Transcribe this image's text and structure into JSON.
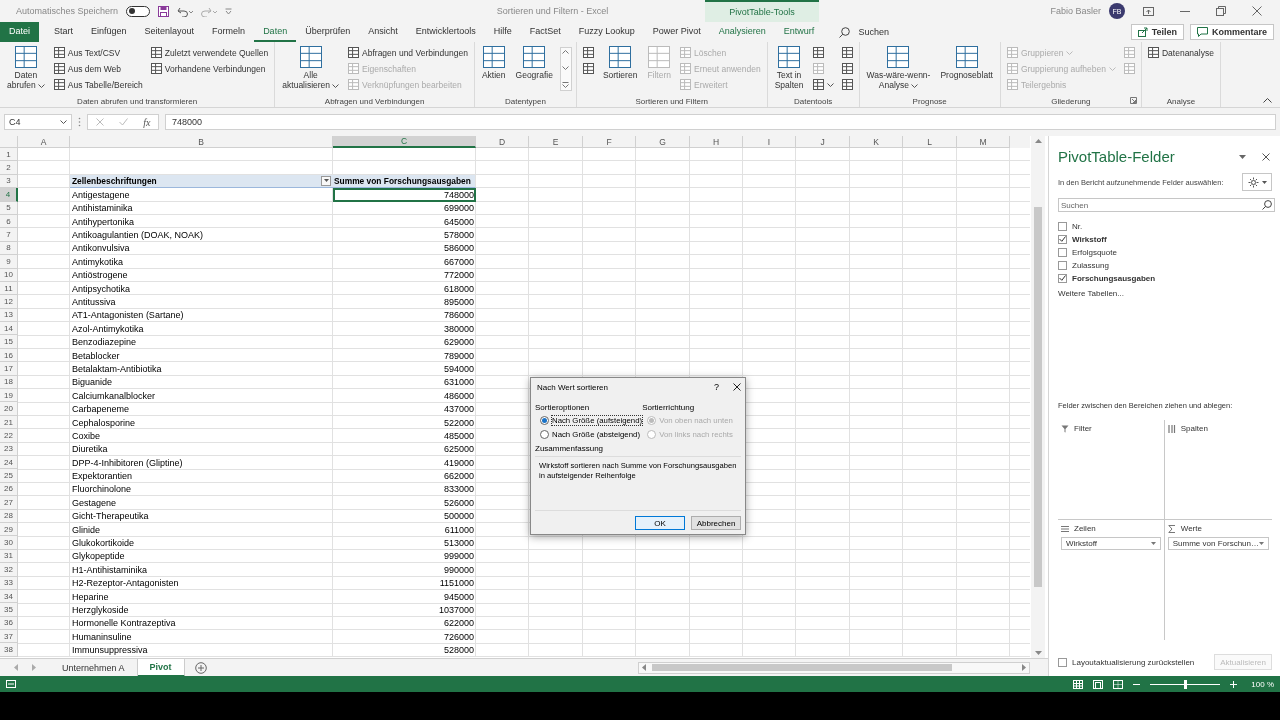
{
  "title_bar": {
    "autosave_label": "Automatisches Speichern",
    "autosave_on": false,
    "document_title": "Sortieren und Filtern - Excel",
    "context_tab": "PivotTable-Tools",
    "user_name": "Fabio Basler",
    "user_initials": "FB"
  },
  "ribbon_tabs": [
    {
      "label": "Datei",
      "kind": "file",
      "selected": false
    },
    {
      "label": "Start",
      "kind": "normal",
      "selected": false
    },
    {
      "label": "Einfügen",
      "kind": "normal",
      "selected": false
    },
    {
      "label": "Seitenlayout",
      "kind": "normal",
      "selected": false
    },
    {
      "label": "Formeln",
      "kind": "normal",
      "selected": false
    },
    {
      "label": "Daten",
      "kind": "normal",
      "selected": true
    },
    {
      "label": "Überprüfen",
      "kind": "normal",
      "selected": false
    },
    {
      "label": "Ansicht",
      "kind": "normal",
      "selected": false
    },
    {
      "label": "Entwicklertools",
      "kind": "normal",
      "selected": false
    },
    {
      "label": "Hilfe",
      "kind": "normal",
      "selected": false
    },
    {
      "label": "FactSet",
      "kind": "normal",
      "selected": false
    },
    {
      "label": "Fuzzy Lookup",
      "kind": "normal",
      "selected": false
    },
    {
      "label": "Power Pivot",
      "kind": "normal",
      "selected": false
    },
    {
      "label": "Analysieren",
      "kind": "context",
      "selected": false
    },
    {
      "label": "Entwurf",
      "kind": "context",
      "selected": false
    }
  ],
  "search_label": "Suchen",
  "share_buttons": [
    {
      "label": "Teilen",
      "kind": "share"
    },
    {
      "label": "Kommentare",
      "kind": "comment"
    }
  ],
  "ribbon_groups": [
    {
      "label": "Daten abrufen und transformieren",
      "controls": [
        {
          "kind": "large",
          "lines": [
            "Daten",
            "abrufen"
          ],
          "dropdown": true,
          "disabled": false
        },
        {
          "kind": "stack",
          "items": [
            {
              "label": "Aus Text/CSV",
              "disabled": false
            },
            {
              "label": "Aus dem Web",
              "disabled": false
            },
            {
              "label": "Aus Tabelle/Bereich",
              "disabled": false
            }
          ]
        },
        {
          "kind": "stack",
          "items": [
            {
              "label": "Zuletzt verwendete Quellen",
              "disabled": false
            },
            {
              "label": "Vorhandene Verbindungen",
              "disabled": false
            }
          ]
        }
      ]
    },
    {
      "label": "Abfragen und Verbindungen",
      "controls": [
        {
          "kind": "large",
          "lines": [
            "Alle",
            "aktualisieren"
          ],
          "dropdown": true,
          "disabled": false
        },
        {
          "kind": "stack",
          "items": [
            {
              "label": "Abfragen und Verbindungen",
              "disabled": false
            },
            {
              "label": "Eigenschaften",
              "disabled": true
            },
            {
              "label": "Verknüpfungen bearbeiten",
              "disabled": true
            }
          ]
        }
      ]
    },
    {
      "label": "Datentypen",
      "controls": [
        {
          "kind": "large",
          "lines": [
            "Aktien"
          ],
          "disabled": false
        },
        {
          "kind": "large",
          "lines": [
            "Geografie"
          ],
          "disabled": false
        },
        {
          "kind": "gallery"
        }
      ]
    },
    {
      "label": "Sortieren und Filtern",
      "controls": [
        {
          "kind": "stack",
          "items": [
            {
              "disabled": false
            },
            {
              "disabled": false
            }
          ]
        },
        {
          "kind": "large",
          "lines": [
            "Sortieren"
          ],
          "disabled": false
        },
        {
          "kind": "large",
          "lines": [
            "Filtern"
          ],
          "disabled": true
        },
        {
          "kind": "stack",
          "items": [
            {
              "label": "Löschen",
              "disabled": true
            },
            {
              "label": "Erneut anwenden",
              "disabled": true
            },
            {
              "label": "Erweitert",
              "disabled": true
            }
          ]
        }
      ]
    },
    {
      "label": "Datentools",
      "controls": [
        {
          "kind": "large",
          "lines": [
            "Text in",
            "Spalten"
          ],
          "disabled": false
        },
        {
          "kind": "stack",
          "items": [
            {
              "disabled": false
            },
            {
              "disabled": true
            },
            {
              "disabled": false,
              "dropdown": true
            }
          ]
        },
        {
          "kind": "stack",
          "items": [
            {
              "disabled": false
            },
            {
              "disabled": false
            },
            {
              "disabled": false
            }
          ]
        }
      ]
    },
    {
      "label": "Prognose",
      "controls": [
        {
          "kind": "large",
          "lines": [
            "Was-wäre-wenn-",
            "Analyse"
          ],
          "dropdown": true,
          "disabled": false
        },
        {
          "kind": "large",
          "lines": [
            "Prognoseblatt"
          ],
          "disabled": false
        }
      ]
    },
    {
      "label": "Gliederung",
      "launcher": true,
      "controls": [
        {
          "kind": "stack",
          "items": [
            {
              "label": "Gruppieren",
              "disabled": true,
              "dropdown": true
            },
            {
              "label": "Gruppierung aufheben",
              "disabled": true,
              "dropdown": true
            },
            {
              "label": "Teilergebnis",
              "disabled": true
            }
          ]
        },
        {
          "kind": "stack",
          "items": [
            {
              "disabled": true
            },
            {
              "disabled": true
            }
          ]
        }
      ]
    },
    {
      "label": "Analyse",
      "controls": [
        {
          "kind": "stack",
          "items": [
            {
              "label": "Datenanalyse",
              "disabled": false
            }
          ]
        }
      ]
    }
  ],
  "formula_bar": {
    "name_box": "C4",
    "function_label": "fx",
    "value": "748000"
  },
  "sheet": {
    "columns": [
      {
        "label": "A",
        "selected": false
      },
      {
        "label": "B",
        "selected": false
      },
      {
        "label": "C",
        "selected": true
      },
      {
        "label": "D",
        "selected": false
      },
      {
        "label": "E",
        "selected": false
      },
      {
        "label": "F",
        "selected": false
      },
      {
        "label": "G",
        "selected": false
      },
      {
        "label": "H",
        "selected": false
      },
      {
        "label": "I",
        "selected": false
      },
      {
        "label": "J",
        "selected": false
      },
      {
        "label": "K",
        "selected": false
      },
      {
        "label": "L",
        "selected": false
      },
      {
        "label": "M",
        "selected": false
      }
    ],
    "rows": [
      {
        "number": "1",
        "kind": "empty",
        "selected": false
      },
      {
        "number": "2",
        "kind": "empty",
        "selected": false
      },
      {
        "number": "3",
        "kind": "header",
        "selected": false,
        "label": "Zellenbeschriftungen",
        "value": "Summe von Forschungsausgaben"
      },
      {
        "number": "4",
        "kind": "data",
        "selected": true,
        "label": "Antigestagene",
        "value": "748000"
      },
      {
        "number": "5",
        "kind": "data",
        "selected": false,
        "label": "Antihistaminika",
        "value": "699000"
      },
      {
        "number": "6",
        "kind": "data",
        "selected": false,
        "label": "Antihypertonika",
        "value": "645000"
      },
      {
        "number": "7",
        "kind": "data",
        "selected": false,
        "label": "Antikoagulantien (DOAK, NOAK)",
        "value": "578000"
      },
      {
        "number": "8",
        "kind": "data",
        "selected": false,
        "label": "Antikonvulsiva",
        "value": "586000"
      },
      {
        "number": "9",
        "kind": "data",
        "selected": false,
        "label": "Antimykotika",
        "value": "667000"
      },
      {
        "number": "10",
        "kind": "data",
        "selected": false,
        "label": "Antiöstrogene",
        "value": "772000"
      },
      {
        "number": "11",
        "kind": "data",
        "selected": false,
        "label": "Antipsychotika",
        "value": "618000"
      },
      {
        "number": "12",
        "kind": "data",
        "selected": false,
        "label": "Antitussiva",
        "value": "895000"
      },
      {
        "number": "13",
        "kind": "data",
        "selected": false,
        "label": "AT1-Antagonisten (Sartane)",
        "value": "786000"
      },
      {
        "number": "14",
        "kind": "data",
        "selected": false,
        "label": "Azol-Antimykotika",
        "value": "380000"
      },
      {
        "number": "15",
        "kind": "data",
        "selected": false,
        "label": "Benzodiazepine",
        "value": "629000"
      },
      {
        "number": "16",
        "kind": "data",
        "selected": false,
        "label": "Betablocker",
        "value": "789000"
      },
      {
        "number": "17",
        "kind": "data",
        "selected": false,
        "label": "Betalaktam-Antibiotika",
        "value": "594000"
      },
      {
        "number": "18",
        "kind": "data",
        "selected": false,
        "label": "Biguanide",
        "value": "631000"
      },
      {
        "number": "19",
        "kind": "data",
        "selected": false,
        "label": "Calciumkanalblocker",
        "value": "486000"
      },
      {
        "number": "20",
        "kind": "data",
        "selected": false,
        "label": "Carbapeneme",
        "value": "437000"
      },
      {
        "number": "21",
        "kind": "data",
        "selected": false,
        "label": "Cephalosporine",
        "value": "522000"
      },
      {
        "number": "22",
        "kind": "data",
        "selected": false,
        "label": "Coxibe",
        "value": "485000"
      },
      {
        "number": "23",
        "kind": "data",
        "selected": false,
        "label": "Diuretika",
        "value": "625000"
      },
      {
        "number": "24",
        "kind": "data",
        "selected": false,
        "label": "DPP-4-Inhibitoren (Gliptine)",
        "value": "419000"
      },
      {
        "number": "25",
        "kind": "data",
        "selected": false,
        "label": "Expektorantien",
        "value": "662000"
      },
      {
        "number": "26",
        "kind": "data",
        "selected": false,
        "label": "Fluorchinolone",
        "value": "833000"
      },
      {
        "number": "27",
        "kind": "data",
        "selected": false,
        "label": "Gestagene",
        "value": "526000"
      },
      {
        "number": "28",
        "kind": "data",
        "selected": false,
        "label": "Gicht-Therapeutika",
        "value": "500000"
      },
      {
        "number": "29",
        "kind": "data",
        "selected": false,
        "label": "Glinide",
        "value": "611000"
      },
      {
        "number": "30",
        "kind": "data",
        "selected": false,
        "label": "Glukokortikoide",
        "value": "513000"
      },
      {
        "number": "31",
        "kind": "data",
        "selected": false,
        "label": "Glykopeptide",
        "value": "999000"
      },
      {
        "number": "32",
        "kind": "data",
        "selected": false,
        "label": "H1-Antihistaminika",
        "value": "990000"
      },
      {
        "number": "33",
        "kind": "data",
        "selected": false,
        "label": "H2-Rezeptor-Antagonisten",
        "value": "1151000"
      },
      {
        "number": "34",
        "kind": "data",
        "selected": false,
        "label": "Heparine",
        "value": "945000"
      },
      {
        "number": "35",
        "kind": "data",
        "selected": false,
        "label": "Herzglykoside",
        "value": "1037000"
      },
      {
        "number": "36",
        "kind": "data",
        "selected": false,
        "label": "Hormonelle Kontrazeptiva",
        "value": "622000"
      },
      {
        "number": "37",
        "kind": "data",
        "selected": false,
        "label": "Humaninsuline",
        "value": "726000"
      },
      {
        "number": "38",
        "kind": "data",
        "selected": false,
        "label": "Immunsuppressiva",
        "value": "528000"
      }
    ]
  },
  "sheet_tabs": [
    {
      "label": "Unternehmen A",
      "selected": false
    },
    {
      "label": "Pivot",
      "selected": true
    }
  ],
  "status_bar": {
    "zoom_slider": {
      "level": 0.5
    },
    "zoom": "100 %"
  },
  "pivot_pane": {
    "title": "PivotTable-Felder",
    "prompt": "In den Bericht aufzunehmende Felder auswählen:",
    "search_placeholder": "Suchen",
    "fields": [
      {
        "label": "Nr.",
        "checked": false
      },
      {
        "label": "Wirkstoff",
        "checked": true
      },
      {
        "label": "Erfolgsquote",
        "checked": false
      },
      {
        "label": "Zulassung",
        "checked": false
      },
      {
        "label": "Forschungsausgaben",
        "checked": true
      }
    ],
    "more_tables": "Weitere Tabellen...",
    "areas_prompt": "Felder zwischen den Bereichen ziehen und ablegen:",
    "areas": [
      {
        "kind": "filter",
        "label": "Filter"
      },
      {
        "kind": "columns",
        "label": "Spalten"
      },
      {
        "kind": "rows",
        "label": "Zeilen",
        "items": [
          "Wirkstoff"
        ]
      },
      {
        "kind": "values",
        "label": "Werte",
        "items": [
          "Summe von Forschun…"
        ]
      }
    ],
    "defer_update": {
      "label": "Layoutaktualisierung zurückstellen",
      "checked": false
    },
    "update_button": {
      "label": "Aktualisieren",
      "disabled": true
    }
  },
  "dialog": {
    "title": "Nach Wert sortieren",
    "help": "?",
    "options_label": "Sortieroptionen",
    "options": [
      {
        "label": "Nach Größe (aufsteigend)",
        "selected": true,
        "disabled": false
      },
      {
        "label": "Nach Größe (absteigend)",
        "selected": false,
        "disabled": false
      }
    ],
    "direction_label": "Sortierrichtung",
    "directions": [
      {
        "label": "Von oben nach unten",
        "selected": true,
        "disabled": true
      },
      {
        "label": "Von links nach rechts",
        "selected": false,
        "disabled": true
      }
    ],
    "summary_label": "Zusammenfassung",
    "summary": "Wirkstoff sortieren nach Summe von Forschungsausgaben in aufsteigender Reihenfolge",
    "buttons": [
      {
        "label": "OK",
        "kind": "default"
      },
      {
        "label": "Abbrechen",
        "kind": "normal"
      }
    ]
  }
}
